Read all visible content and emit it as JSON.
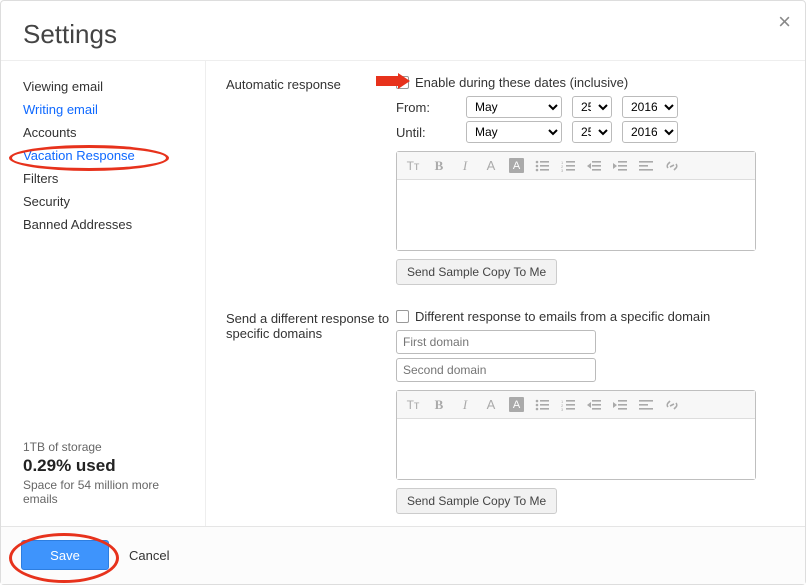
{
  "title": "Settings",
  "sidebar": {
    "items": [
      {
        "label": "Viewing email",
        "state": "normal"
      },
      {
        "label": "Writing email",
        "state": "link"
      },
      {
        "label": "Accounts",
        "state": "normal"
      },
      {
        "label": "Vacation Response",
        "state": "active"
      },
      {
        "label": "Filters",
        "state": "normal"
      },
      {
        "label": "Security",
        "state": "normal"
      },
      {
        "label": "Banned Addresses",
        "state": "normal"
      }
    ]
  },
  "storage": {
    "line1": "1TB of storage",
    "pct": "0.29% used",
    "line2": "Space for 54 million more emails"
  },
  "auto": {
    "section_label": "Automatic response",
    "enable_label": "Enable during these dates (inclusive)",
    "from_label": "From:",
    "until_label": "Until:",
    "from": {
      "month": "May",
      "day": "25",
      "year": "2016"
    },
    "until": {
      "month": "May",
      "day": "25",
      "year": "2016"
    },
    "sample_btn": "Send Sample Copy To Me"
  },
  "domain": {
    "section_label": "Send a different response to specific domains",
    "check_label": "Different response to emails from a specific domain",
    "ph1": "First domain",
    "ph2": "Second domain",
    "sample_btn": "Send Sample Copy To Me"
  },
  "footer": {
    "save": "Save",
    "cancel": "Cancel"
  },
  "icons": {
    "tsize": "Tᴛ",
    "bold": "B",
    "italic": "I",
    "color": "A",
    "hilite": "A"
  }
}
